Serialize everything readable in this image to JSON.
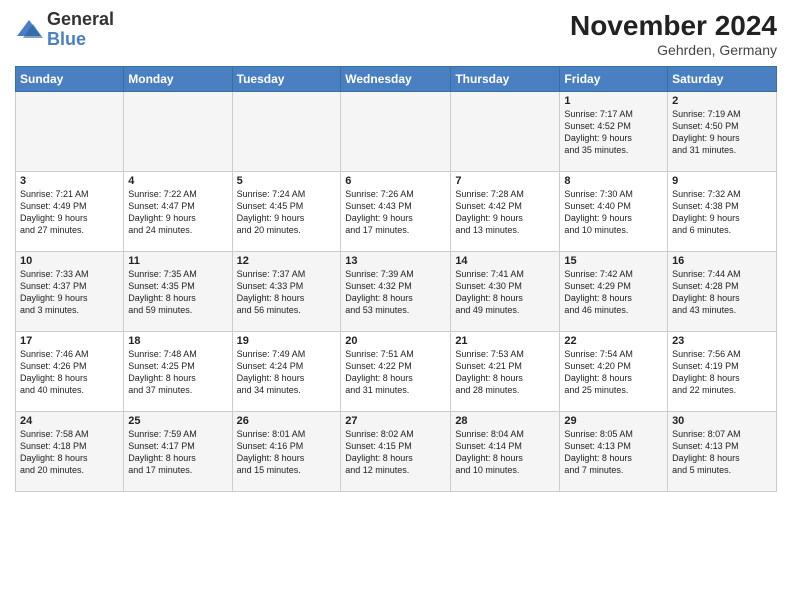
{
  "logo": {
    "general": "General",
    "blue": "Blue"
  },
  "title": "November 2024",
  "location": "Gehrden, Germany",
  "days_header": [
    "Sunday",
    "Monday",
    "Tuesday",
    "Wednesday",
    "Thursday",
    "Friday",
    "Saturday"
  ],
  "weeks": [
    [
      {
        "day": "",
        "info": ""
      },
      {
        "day": "",
        "info": ""
      },
      {
        "day": "",
        "info": ""
      },
      {
        "day": "",
        "info": ""
      },
      {
        "day": "",
        "info": ""
      },
      {
        "day": "1",
        "info": "Sunrise: 7:17 AM\nSunset: 4:52 PM\nDaylight: 9 hours\nand 35 minutes."
      },
      {
        "day": "2",
        "info": "Sunrise: 7:19 AM\nSunset: 4:50 PM\nDaylight: 9 hours\nand 31 minutes."
      }
    ],
    [
      {
        "day": "3",
        "info": "Sunrise: 7:21 AM\nSunset: 4:49 PM\nDaylight: 9 hours\nand 27 minutes."
      },
      {
        "day": "4",
        "info": "Sunrise: 7:22 AM\nSunset: 4:47 PM\nDaylight: 9 hours\nand 24 minutes."
      },
      {
        "day": "5",
        "info": "Sunrise: 7:24 AM\nSunset: 4:45 PM\nDaylight: 9 hours\nand 20 minutes."
      },
      {
        "day": "6",
        "info": "Sunrise: 7:26 AM\nSunset: 4:43 PM\nDaylight: 9 hours\nand 17 minutes."
      },
      {
        "day": "7",
        "info": "Sunrise: 7:28 AM\nSunset: 4:42 PM\nDaylight: 9 hours\nand 13 minutes."
      },
      {
        "day": "8",
        "info": "Sunrise: 7:30 AM\nSunset: 4:40 PM\nDaylight: 9 hours\nand 10 minutes."
      },
      {
        "day": "9",
        "info": "Sunrise: 7:32 AM\nSunset: 4:38 PM\nDaylight: 9 hours\nand 6 minutes."
      }
    ],
    [
      {
        "day": "10",
        "info": "Sunrise: 7:33 AM\nSunset: 4:37 PM\nDaylight: 9 hours\nand 3 minutes."
      },
      {
        "day": "11",
        "info": "Sunrise: 7:35 AM\nSunset: 4:35 PM\nDaylight: 8 hours\nand 59 minutes."
      },
      {
        "day": "12",
        "info": "Sunrise: 7:37 AM\nSunset: 4:33 PM\nDaylight: 8 hours\nand 56 minutes."
      },
      {
        "day": "13",
        "info": "Sunrise: 7:39 AM\nSunset: 4:32 PM\nDaylight: 8 hours\nand 53 minutes."
      },
      {
        "day": "14",
        "info": "Sunrise: 7:41 AM\nSunset: 4:30 PM\nDaylight: 8 hours\nand 49 minutes."
      },
      {
        "day": "15",
        "info": "Sunrise: 7:42 AM\nSunset: 4:29 PM\nDaylight: 8 hours\nand 46 minutes."
      },
      {
        "day": "16",
        "info": "Sunrise: 7:44 AM\nSunset: 4:28 PM\nDaylight: 8 hours\nand 43 minutes."
      }
    ],
    [
      {
        "day": "17",
        "info": "Sunrise: 7:46 AM\nSunset: 4:26 PM\nDaylight: 8 hours\nand 40 minutes."
      },
      {
        "day": "18",
        "info": "Sunrise: 7:48 AM\nSunset: 4:25 PM\nDaylight: 8 hours\nand 37 minutes."
      },
      {
        "day": "19",
        "info": "Sunrise: 7:49 AM\nSunset: 4:24 PM\nDaylight: 8 hours\nand 34 minutes."
      },
      {
        "day": "20",
        "info": "Sunrise: 7:51 AM\nSunset: 4:22 PM\nDaylight: 8 hours\nand 31 minutes."
      },
      {
        "day": "21",
        "info": "Sunrise: 7:53 AM\nSunset: 4:21 PM\nDaylight: 8 hours\nand 28 minutes."
      },
      {
        "day": "22",
        "info": "Sunrise: 7:54 AM\nSunset: 4:20 PM\nDaylight: 8 hours\nand 25 minutes."
      },
      {
        "day": "23",
        "info": "Sunrise: 7:56 AM\nSunset: 4:19 PM\nDaylight: 8 hours\nand 22 minutes."
      }
    ],
    [
      {
        "day": "24",
        "info": "Sunrise: 7:58 AM\nSunset: 4:18 PM\nDaylight: 8 hours\nand 20 minutes."
      },
      {
        "day": "25",
        "info": "Sunrise: 7:59 AM\nSunset: 4:17 PM\nDaylight: 8 hours\nand 17 minutes."
      },
      {
        "day": "26",
        "info": "Sunrise: 8:01 AM\nSunset: 4:16 PM\nDaylight: 8 hours\nand 15 minutes."
      },
      {
        "day": "27",
        "info": "Sunrise: 8:02 AM\nSunset: 4:15 PM\nDaylight: 8 hours\nand 12 minutes."
      },
      {
        "day": "28",
        "info": "Sunrise: 8:04 AM\nSunset: 4:14 PM\nDaylight: 8 hours\nand 10 minutes."
      },
      {
        "day": "29",
        "info": "Sunrise: 8:05 AM\nSunset: 4:13 PM\nDaylight: 8 hours\nand 7 minutes."
      },
      {
        "day": "30",
        "info": "Sunrise: 8:07 AM\nSunset: 4:13 PM\nDaylight: 8 hours\nand 5 minutes."
      }
    ]
  ]
}
